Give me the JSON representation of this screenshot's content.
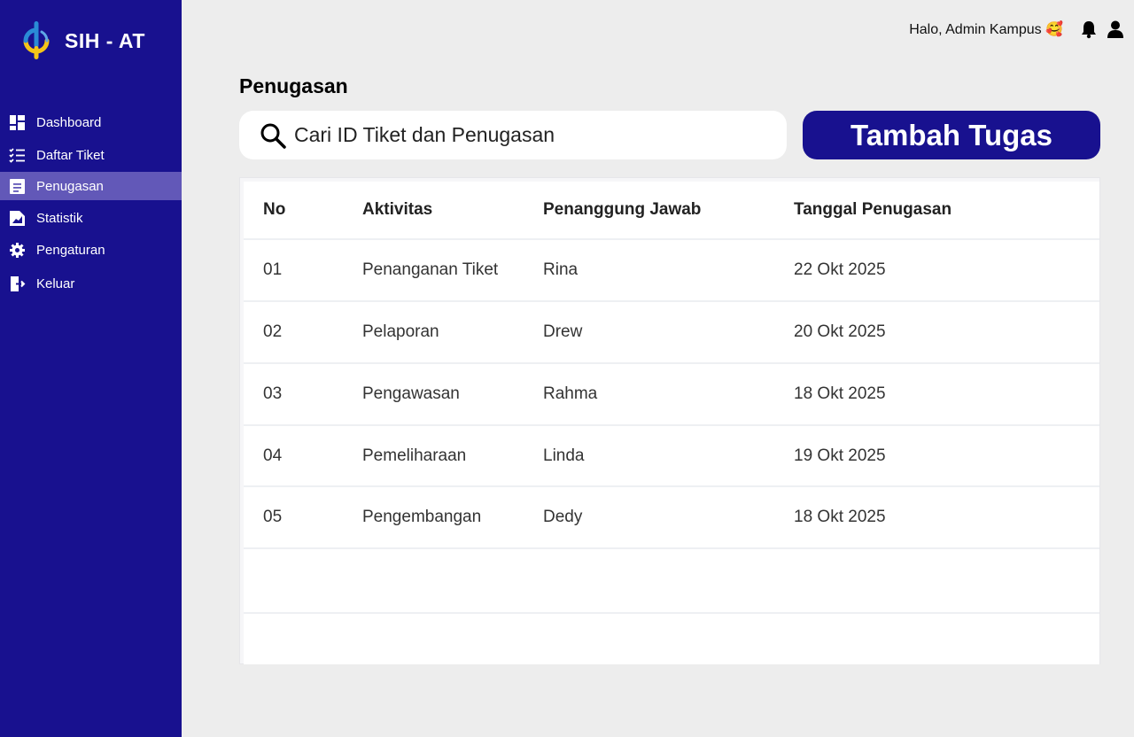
{
  "brand": {
    "name": "SIH - AT"
  },
  "nav": [
    {
      "label": "Dashboard",
      "icon": "dashboard-icon",
      "active": false
    },
    {
      "label": "Daftar Tiket",
      "icon": "checklist-icon",
      "active": false
    },
    {
      "label": "Penugasan",
      "icon": "assignment-icon",
      "active": true
    },
    {
      "label": "Statistik",
      "icon": "chart-icon",
      "active": false
    },
    {
      "label": "Pengaturan",
      "icon": "gear-icon",
      "active": false
    },
    {
      "label": "Keluar",
      "icon": "logout-icon",
      "active": false
    }
  ],
  "header": {
    "greeting": "Halo, Admin Kampus 🥰"
  },
  "main": {
    "title": "Penugasan",
    "search_placeholder": "Cari ID Tiket dan Penugasan",
    "add_label": "Tambah Tugas"
  },
  "table": {
    "headers": [
      "No",
      "Aktivitas",
      "Penanggung Jawab",
      "Tanggal Penugasan"
    ],
    "rows": [
      [
        "01",
        "Penanganan Tiket",
        "Rina",
        "22 Okt 2025"
      ],
      [
        "02",
        "Pelaporan",
        "Drew",
        "20 Okt 2025"
      ],
      [
        "03",
        "Pengawasan",
        "Rahma",
        "18 Okt 2025"
      ],
      [
        "04",
        "Pemeliharaan",
        "Linda",
        "19 Okt 2025"
      ],
      [
        "05",
        "Pengembangan",
        "Dedy",
        "18 Okt 2025"
      ]
    ]
  },
  "colors": {
    "sidebar": "#18118f",
    "active": "#6258b8",
    "accent_yellow": "#f5c518",
    "accent_blue": "#2a8bd6"
  }
}
